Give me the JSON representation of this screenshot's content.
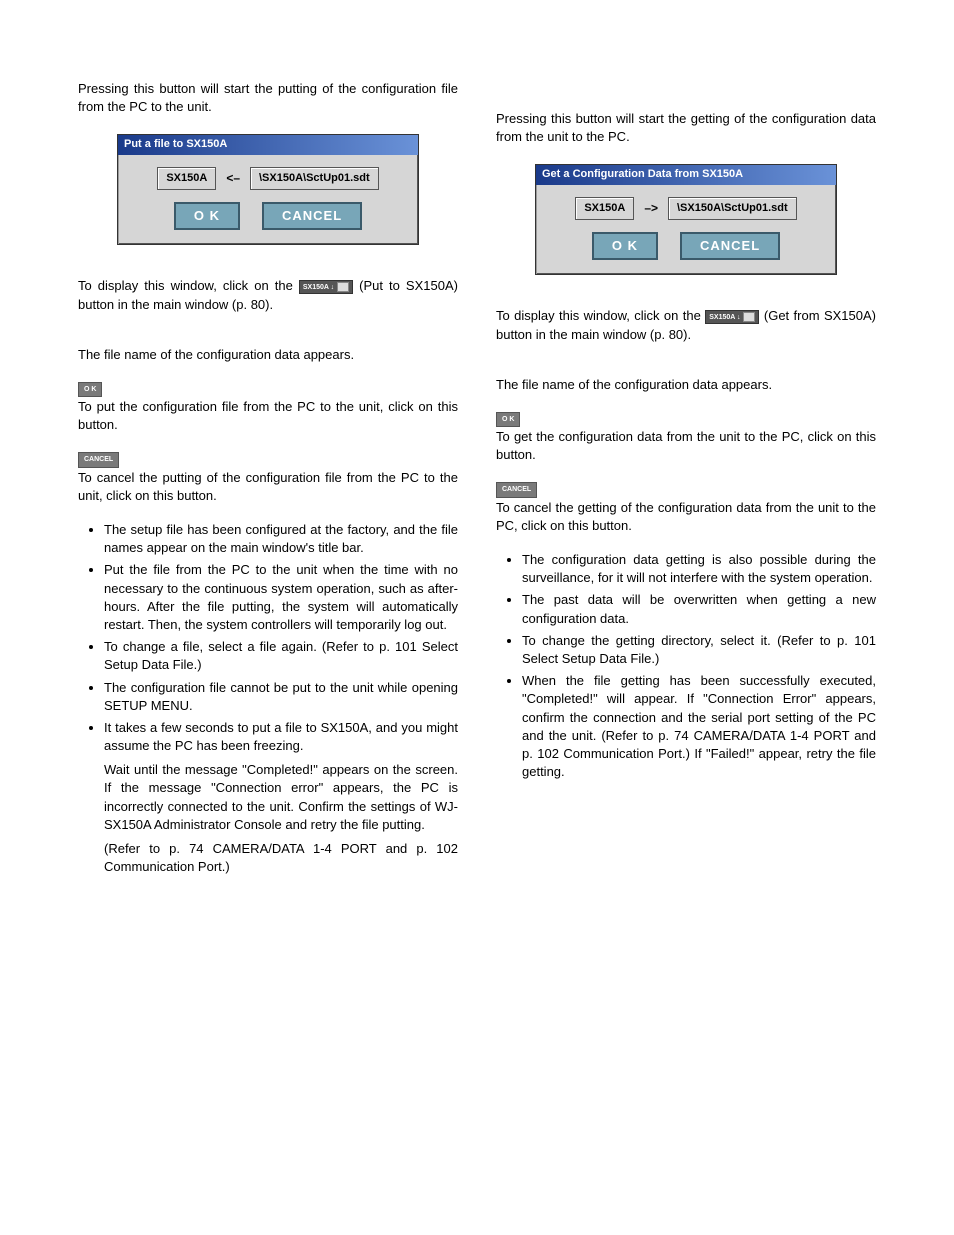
{
  "left": {
    "intro": "Pressing this button will start the putting of the configuration file from the PC to the unit.",
    "dialog": {
      "title": "Put a file to SX150A",
      "device": "SX150A",
      "arrow": "<–",
      "path": "\\SX150A\\SctUp01.sdt",
      "ok": "O K",
      "cancel": "CANCEL"
    },
    "display_pre": "To display this window, click on the ",
    "icon_label": "SX150A",
    "display_post": " (Put to SX150A) button in the main window (p. 80).",
    "filename_line": "The file name of the configuration data appears.",
    "ok_small": "O K",
    "ok_desc": "To put the configuration file from the PC to the unit, click on this button.",
    "cancel_small": "CANCEL",
    "cancel_desc": "To cancel the putting of the configuration file from the PC to the unit, click on this button.",
    "bullets": [
      "The setup file has been configured at the factory, and the file names appear on the main window's title bar.",
      "Put the file from the PC to the unit when the time with no necessary to the continuous system operation, such as after-hours. After the file putting, the system will automatically restart. Then, the system controllers will temporarily log out.",
      "To change a file, select a file again. (Refer to p. 101 Select Setup Data File.)",
      "The configuration file cannot be put to the unit while opening SETUP MENU.",
      "It takes a few seconds to put a file to SX150A, and you might assume the PC has been freezing."
    ],
    "tail": [
      "Wait until the message \"Completed!\" appears on the screen. If the message \"Connection error\" appears, the PC is incorrectly connected to the unit. Confirm the settings of WJ-SX150A Administrator Console and retry the file putting.",
      "(Refer to p. 74 CAMERA/DATA 1-4 PORT and p. 102 Communication Port.)"
    ]
  },
  "right": {
    "intro": "Pressing this button will start the getting of the configuration data from the unit to the PC.",
    "dialog": {
      "title": "Get a Configuration Data from SX150A",
      "device": "SX150A",
      "arrow": "–>",
      "path": "\\SX150A\\SctUp01.sdt",
      "ok": "O K",
      "cancel": "CANCEL"
    },
    "display_pre": "To display this window, click on the ",
    "icon_label": "SX150A",
    "display_post": " (Get from SX150A) button in the main window (p. 80).",
    "filename_line": "The file name of the configuration data appears.",
    "ok_small": "O K",
    "ok_desc": "To get the configuration data from the unit to the PC, click on this button.",
    "cancel_small": "CANCEL",
    "cancel_desc": "To cancel the getting of the configuration data from the unit to the PC, click on this button.",
    "bullets": [
      "The configuration data getting is also possible during the surveillance, for it will not interfere with the system operation.",
      "The past data will be overwritten when getting a new configuration data.",
      "To change the getting directory, select it. (Refer to p. 101 Select Setup Data File.)",
      "When the file getting has been successfully executed, \"Completed!\" will appear. If \"Connection Error\" appears, confirm the connection and the serial port setting of the PC and the unit. (Refer to p. 74 CAMERA/DATA 1-4 PORT and p. 102 Communication Port.) If \"Failed!\" appear, retry the file getting."
    ]
  }
}
